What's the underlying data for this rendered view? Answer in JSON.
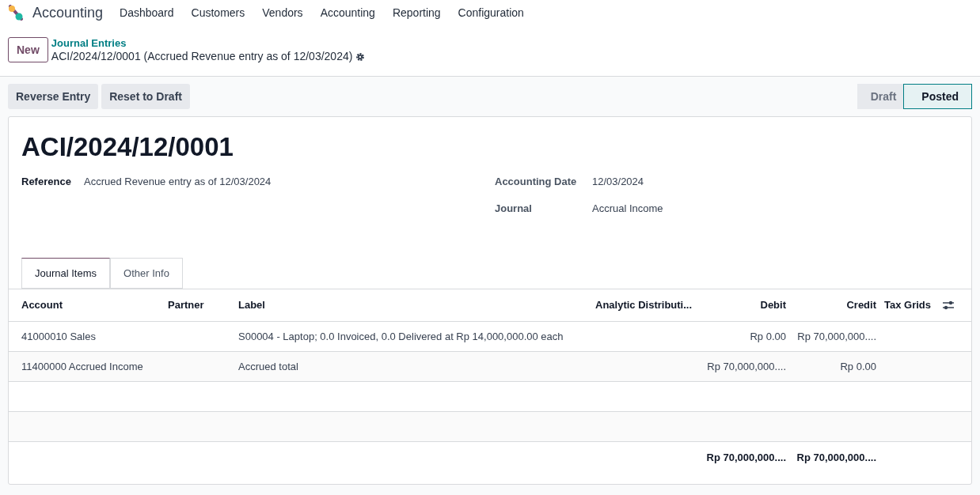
{
  "navbar": {
    "app_name": "Accounting",
    "menu": [
      "Dashboard",
      "Customers",
      "Vendors",
      "Accounting",
      "Reporting",
      "Configuration"
    ]
  },
  "control_panel": {
    "new_button": "New",
    "breadcrumb": "Journal Entries",
    "record_title": "ACI/2024/12/0001 (Accrued Revenue entry as of 12/03/2024)"
  },
  "actions": [
    "Reverse Entry",
    "Reset to Draft"
  ],
  "statusbar": [
    {
      "label": "Draft",
      "selected": false
    },
    {
      "label": "Posted",
      "selected": true
    }
  ],
  "form": {
    "title": "ACI/2024/12/0001",
    "left_fields": [
      {
        "label": "Reference",
        "value": "Accrued Revenue entry as of 12/03/2024"
      }
    ],
    "right_fields": [
      {
        "label": "Accounting Date",
        "value": "12/03/2024"
      },
      {
        "label": "Journal",
        "value": "Accrual Income"
      }
    ]
  },
  "tabs": [
    {
      "label": "Journal Items",
      "selected": true
    },
    {
      "label": "Other Info",
      "selected": false
    }
  ],
  "table": {
    "columns": [
      "Account",
      "Partner",
      "Label",
      "Analytic Distributi...",
      "Debit",
      "Credit",
      "Tax Grids"
    ],
    "rows": [
      {
        "account": "41000010 Sales",
        "label": "S00004 - Laptop; 0.0 Invoiced, 0.0 Delivered at Rp 14,000,000.00 each",
        "debit": "Rp 0.00",
        "credit": "Rp 70,000,000...."
      },
      {
        "account": "11400000 Accrued Income",
        "label": "Accrued total",
        "debit": "Rp 70,000,000....",
        "credit": "Rp 0.00"
      }
    ],
    "totals": {
      "debit": "Rp 70,000,000....",
      "credit": "Rp 70,000,000...."
    }
  }
}
